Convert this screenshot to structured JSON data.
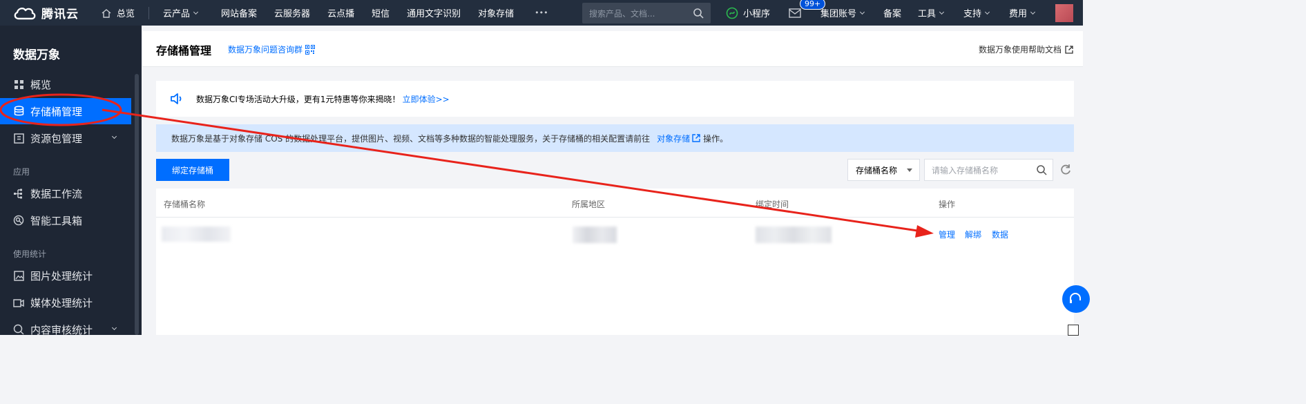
{
  "topbar": {
    "brand": "腾讯云",
    "overview": "总览",
    "products": "云产品",
    "nav": [
      "网站备案",
      "云服务器",
      "云点播",
      "短信",
      "通用文字识别",
      "对象存储"
    ],
    "more": "•••",
    "search_placeholder": "搜索产品、文档...",
    "mini_program": "小程序",
    "badge": "99+",
    "group_account": "集团账号",
    "beian": "备案",
    "tools": "工具",
    "support": "支持",
    "billing": "费用"
  },
  "sidebar": {
    "title": "数据万象",
    "items": {
      "overview": "概览",
      "bucket": "存储桶管理",
      "package": "资源包管理",
      "workflow": "数据工作流",
      "toolbox": "智能工具箱",
      "img_stats": "图片处理统计",
      "media_stats": "媒体处理统计",
      "audit_stats": "内容审核统计"
    },
    "groups": {
      "app": "应用",
      "usage": "使用统计"
    }
  },
  "header": {
    "title": "存储桶管理",
    "group_link": "数据万象问题咨询群",
    "help": "数据万象使用帮助文档"
  },
  "notice": {
    "text": "数据万象CI专场活动大升级，更有1元特惠等你来揭晓！",
    "link": "立即体验>>"
  },
  "info": {
    "text": "数据万象是基于对象存储 COS 的数据处理平台，提供图片、视频、文档等多种数据的智能处理服务，关于存储桶的相关配置请前往",
    "link": "对象存储",
    "suffix": "操作。"
  },
  "toolbar": {
    "bind_button": "绑定存储桶",
    "filter_selected": "存储桶名称",
    "search_placeholder": "请输入存储桶名称"
  },
  "table": {
    "headers": [
      "存储桶名称",
      "所属地区",
      "绑定时间",
      "操作"
    ],
    "actions": [
      "管理",
      "解绑",
      "数据"
    ]
  },
  "colors": {
    "accent": "#006eff",
    "annotation": "#e8231b",
    "topbar": "#232e3e",
    "sidebar": "#1e2634"
  }
}
